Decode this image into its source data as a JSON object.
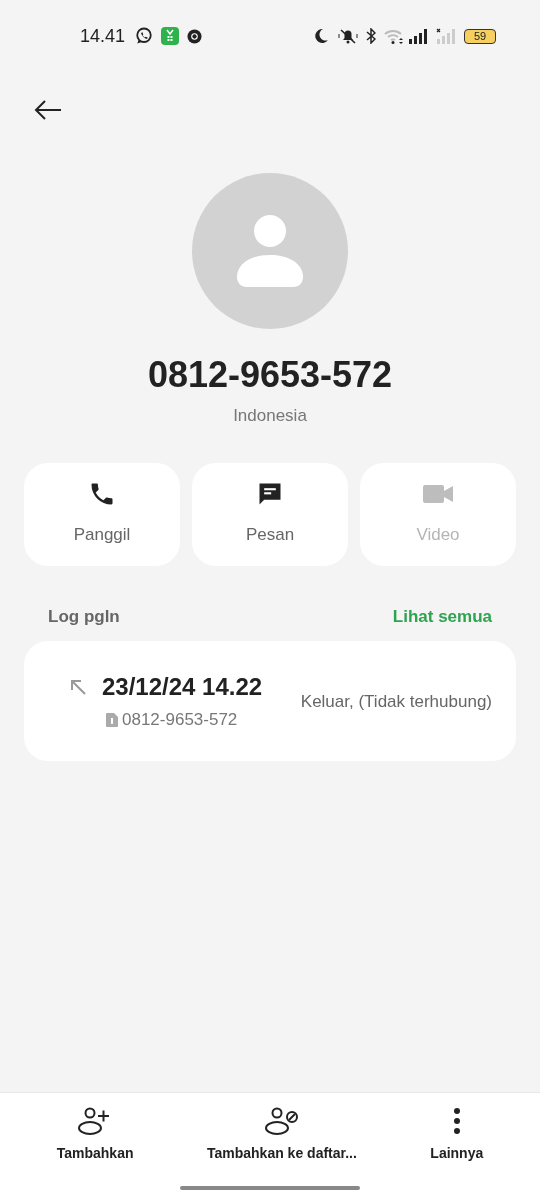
{
  "status_bar": {
    "time": "14.41",
    "battery": "59"
  },
  "contact": {
    "number": "0812-9653-572",
    "location": "Indonesia"
  },
  "actions": [
    {
      "kind": "call",
      "label": "Panggil",
      "disabled": false
    },
    {
      "kind": "message",
      "label": "Pesan",
      "disabled": false
    },
    {
      "kind": "video",
      "label": "Video",
      "disabled": true
    }
  ],
  "call_log": {
    "title": "Log pgln",
    "see_all": "Lihat semua",
    "entries": [
      {
        "datetime": "23/12/24 14.22",
        "sim_number": "0812-9653-572",
        "status": "Keluar, (Tidak terhubung)"
      }
    ]
  },
  "bottom_bar": [
    {
      "kind": "add",
      "label": "Tambahkan"
    },
    {
      "kind": "block",
      "label": "Tambahkan ke daftar..."
    },
    {
      "kind": "more",
      "label": "Lainnya"
    }
  ]
}
